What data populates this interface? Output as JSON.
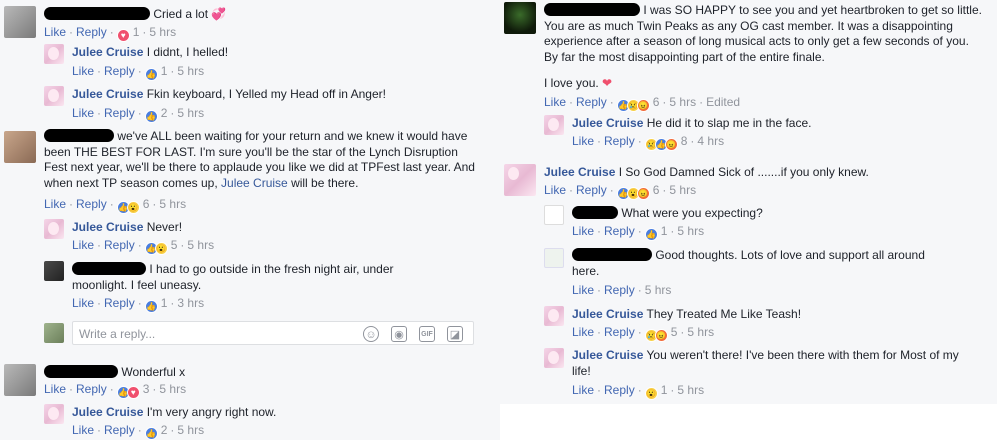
{
  "left": {
    "c1": {
      "text": "Cried a lot",
      "actions": {
        "like": "Like",
        "reply": "Reply",
        "count": "1",
        "time": "5 hrs"
      }
    },
    "r1": {
      "name": "Julee Cruise",
      "text": "I didnt, I helled!",
      "actions": {
        "like": "Like",
        "reply": "Reply",
        "count": "1",
        "time": "5 hrs"
      }
    },
    "r2": {
      "name": "Julee Cruise",
      "text": "Fkin keyboard, I Yelled my Head off in Anger!",
      "actions": {
        "like": "Like",
        "reply": "Reply",
        "count": "2",
        "time": "5 hrs"
      }
    },
    "c2": {
      "text_a": "we've ALL been waiting for your return and we knew it would have",
      "text_b": "been THE BEST FOR LAST. I'm sure you'll be the star of the Lynch Disruption",
      "text_c": "Fest next year, we'll be there to applaude you like we did at TPFest last year. And",
      "text_d": "when next TP season comes up,",
      "mention": "Julee Cruise",
      "text_e": "will be there.",
      "actions": {
        "like": "Like",
        "reply": "Reply",
        "count": "6",
        "time": "5 hrs"
      }
    },
    "r3": {
      "name": "Julee Cruise",
      "text": "Never!",
      "actions": {
        "like": "Like",
        "reply": "Reply",
        "count": "5",
        "time": "5 hrs"
      }
    },
    "r4": {
      "text_a": "I had to go outside in the fresh night air, under",
      "text_b": "moonlight. I feel uneasy.",
      "actions": {
        "like": "Like",
        "reply": "Reply",
        "count": "1",
        "time": "3 hrs"
      }
    },
    "reply_placeholder": "Write a reply...",
    "c3": {
      "text": "Wonderful x",
      "actions": {
        "like": "Like",
        "reply": "Reply",
        "count": "3",
        "time": "5 hrs"
      }
    },
    "r5": {
      "name": "Julee Cruise",
      "text": "I'm very angry right now.",
      "actions": {
        "like": "Like",
        "reply": "Reply",
        "count": "2",
        "time": "5 hrs"
      }
    }
  },
  "right": {
    "c1": {
      "text_a": "I was SO HAPPY to see you and yet heartbroken to get so little.",
      "text_b": "You are as much Twin Peaks as any OG cast member. It was a disappointing",
      "text_c": "experience after a season of long musical acts to only get a few seconds of you.",
      "text_d": "By far the most disappointing part of the entire finale.",
      "text_e": "I love you.",
      "actions": {
        "like": "Like",
        "reply": "Reply",
        "count": "6",
        "time": "5 hrs",
        "edited": "Edited"
      }
    },
    "r1": {
      "name": "Julee Cruise",
      "text": "He did it to slap me in the face.",
      "actions": {
        "like": "Like",
        "reply": "Reply",
        "count": "8",
        "time": "4 hrs"
      }
    },
    "c2": {
      "name": "Julee Cruise",
      "text": "I So God Damned Sick of .......if you only knew.",
      "actions": {
        "like": "Like",
        "reply": "Reply",
        "count": "6",
        "time": "5 hrs"
      }
    },
    "r2": {
      "text": "What were you expecting?",
      "actions": {
        "like": "Like",
        "reply": "Reply",
        "count": "1",
        "time": "5 hrs"
      }
    },
    "r3": {
      "text_a": "Good thoughts. Lots of love and support all around",
      "text_b": "here.",
      "actions": {
        "like": "Like",
        "reply": "Reply",
        "time": "5 hrs"
      }
    },
    "r4": {
      "name": "Julee Cruise",
      "text": "They Treated Me Like Teash!",
      "actions": {
        "like": "Like",
        "reply": "Reply",
        "count": "5",
        "time": "5 hrs"
      }
    },
    "r5": {
      "name": "Julee Cruise",
      "text_a": "You weren't there! I've been there with them for Most of my",
      "text_b": "life!",
      "actions": {
        "like": "Like",
        "reply": "Reply",
        "count": "1",
        "time": "5 hrs"
      }
    }
  },
  "colors": {
    "link": "#365899",
    "action": "#4267b2",
    "meta": "#90949c",
    "panel": "#f6f7f9"
  }
}
